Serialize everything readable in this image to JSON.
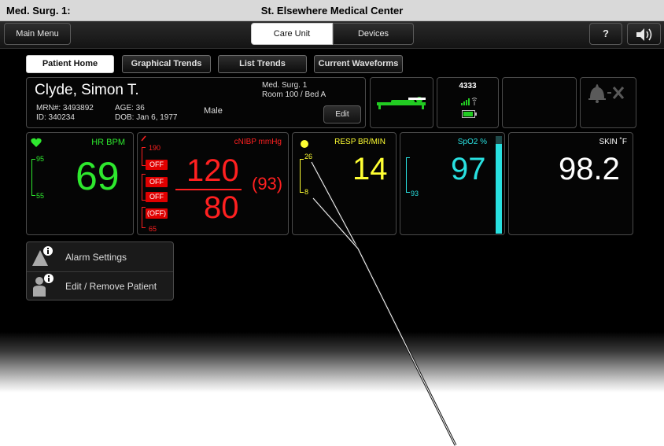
{
  "title_bar": {
    "left": "Med. Surg. 1:",
    "center": "St. Elsewhere Medical Center"
  },
  "nav": {
    "main_menu": "Main Menu",
    "segments": [
      "Care Unit",
      "Devices"
    ],
    "help": "?",
    "sound_icon": "speaker-icon"
  },
  "tabs": [
    "Patient Home",
    "Graphical Trends",
    "List Trends",
    "Current Waveforms"
  ],
  "patient": {
    "name": "Clyde, Simon T.",
    "mrn": "MRN#: 3493892",
    "id": "ID: 340234",
    "age": "AGE: 36",
    "dob": "DOB: Jan 6, 1977",
    "sex": "Male",
    "unit": "Med. Surg. 1",
    "room": "Room 100 / Bed A",
    "edit": "Edit"
  },
  "device": {
    "number": "4333",
    "battery_icon": "battery-icon",
    "signal_icon": "signal-icon"
  },
  "vitals": {
    "hr": {
      "label": "HR BPM",
      "value": "69",
      "high": "95",
      "low": "55",
      "color": "#2ee82e"
    },
    "nibp": {
      "label": "cNIBP mmHg",
      "systolic": "120",
      "diastolic": "80",
      "mean": "(93)",
      "high": "190",
      "low": "65",
      "off": [
        "OFF",
        "OFF",
        "OFF",
        "(OFF)"
      ],
      "color": "#ff2020"
    },
    "resp": {
      "label": "RESP BR/MIN",
      "value": "14",
      "high": "26",
      "low": "8",
      "color": "#ffff33"
    },
    "spo2": {
      "label": "SpO2 %",
      "value": "97",
      "low": "93",
      "level": 0.92,
      "color": "#29e0e0"
    },
    "skin": {
      "label": "SKIN ˚F",
      "value": "98.2",
      "color": "#ffffff"
    }
  },
  "menu": {
    "alarm_settings": "Alarm Settings",
    "edit_remove_patient": "Edit / Remove Patient"
  }
}
